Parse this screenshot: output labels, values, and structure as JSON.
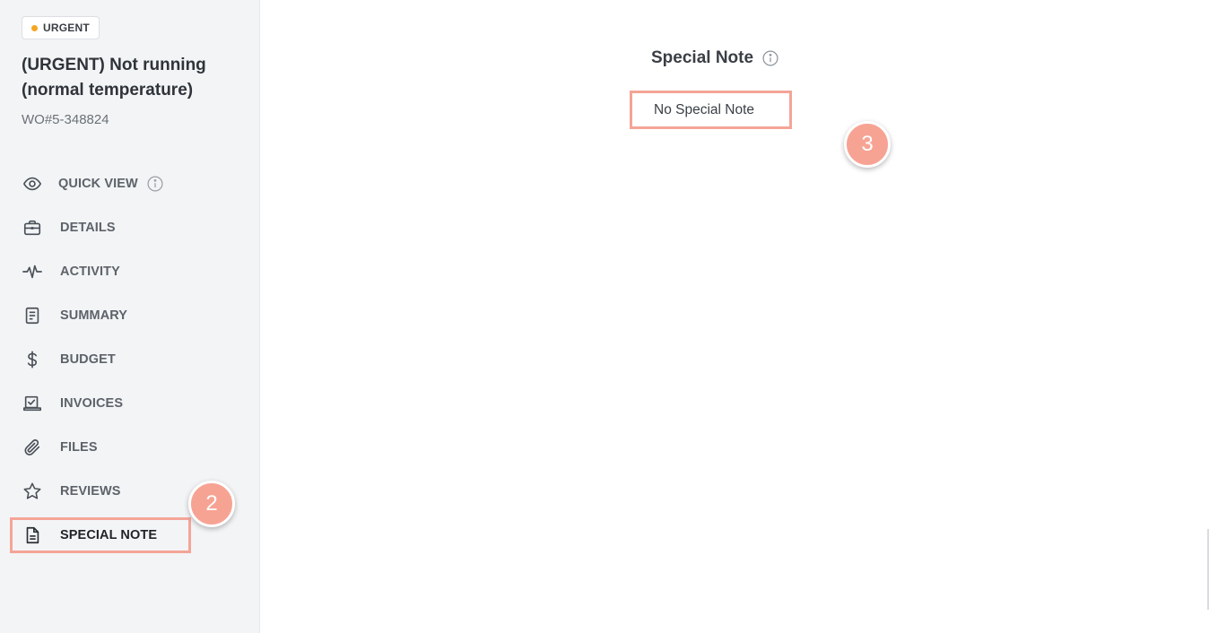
{
  "badge": {
    "label": "URGENT",
    "dot_color": "#f5a623"
  },
  "work_order": {
    "title": "(URGENT) Not running (normal temperature)",
    "number": "WO#5-348824"
  },
  "nav": {
    "items": [
      {
        "label": "QUICK VIEW",
        "icon": "eye-icon"
      },
      {
        "label": "DETAILS",
        "icon": "briefcase-icon"
      },
      {
        "label": "ACTIVITY",
        "icon": "activity-pulse-icon"
      },
      {
        "label": "SUMMARY",
        "icon": "document-icon"
      },
      {
        "label": "BUDGET",
        "icon": "dollar-icon"
      },
      {
        "label": "INVOICES",
        "icon": "invoice-check-icon"
      },
      {
        "label": "FILES",
        "icon": "paperclip-icon"
      },
      {
        "label": "REVIEWS",
        "icon": "star-icon"
      },
      {
        "label": "SPECIAL NOTE",
        "icon": "note-file-icon"
      }
    ],
    "active": "SPECIAL NOTE"
  },
  "main": {
    "section_title": "Special Note",
    "note_text": "No Special Note"
  },
  "annotations": {
    "step_2": "2",
    "step_3": "3",
    "highlight_color": "#f4a597"
  }
}
